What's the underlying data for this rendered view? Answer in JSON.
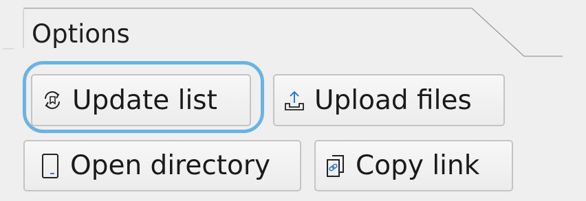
{
  "window": {
    "title": "Options"
  },
  "buttons": {
    "update": {
      "label": "Update list",
      "icon": "refresh-icon"
    },
    "upload": {
      "label": "Upload files",
      "icon": "upload-icon"
    },
    "open": {
      "label": "Open directory",
      "icon": "tablet-icon"
    },
    "copy": {
      "label": "Copy link",
      "icon": "copy-link-icon"
    }
  },
  "colors": {
    "focus_ring": "#6ab3e3",
    "background": "#efefef",
    "icon_blue": "#2f79c6"
  },
  "focused_button": "update"
}
